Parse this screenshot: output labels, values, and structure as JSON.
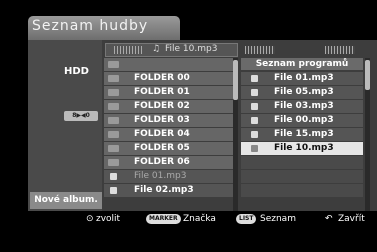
{
  "title": "Seznam hudby",
  "left_panel": {
    "drive": "HDD",
    "badge": "8▶◀0",
    "new_album": "Nové album."
  },
  "path": {
    "note_icon": "♫",
    "current": "File 10.mp3"
  },
  "left_list": [
    {
      "type": "up",
      "label": ""
    },
    {
      "type": "folder",
      "label": "FOLDER 00"
    },
    {
      "type": "folder",
      "label": "FOLDER 01"
    },
    {
      "type": "folder",
      "label": "FOLDER 02"
    },
    {
      "type": "folder",
      "label": "FOLDER 03"
    },
    {
      "type": "folder",
      "label": "FOLDER 04"
    },
    {
      "type": "folder",
      "label": "FOLDER 05"
    },
    {
      "type": "folder",
      "label": "FOLDER 06"
    },
    {
      "type": "file",
      "label": "File 01.mp3"
    },
    {
      "type": "file",
      "label": "File 02.mp3"
    }
  ],
  "program": {
    "header": "Seznam programů",
    "items": [
      "File 01.mp3",
      "File 05.mp3",
      "File 03.mp3",
      "File 00.mp3",
      "File 15.mp3",
      "File 10.mp3"
    ],
    "selected_index": 5
  },
  "footer": {
    "select_icon": "⊙",
    "select": "zvolit",
    "marker_badge": "MARKER",
    "marker": "Značka",
    "list_badge": "LIST",
    "list": "Seznam",
    "close_icon": "↶",
    "close": "Zavřít"
  }
}
